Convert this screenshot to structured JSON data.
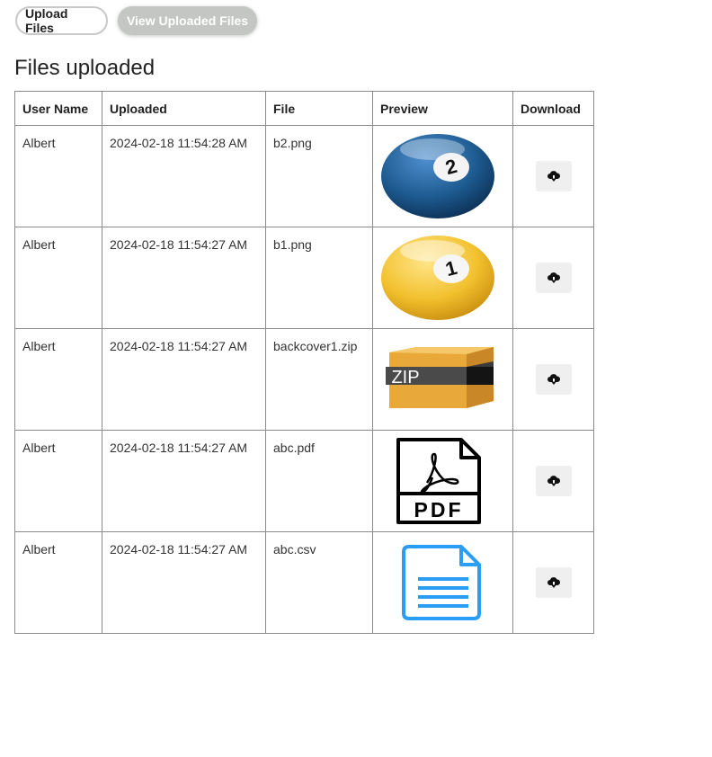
{
  "nav": {
    "upload_label": "Upload Files",
    "view_label": "View Uploaded Files"
  },
  "page_title": "Files uploaded",
  "table": {
    "headers": [
      "User Name",
      "Uploaded",
      "File",
      "Preview",
      "Download"
    ],
    "rows": [
      {
        "user": "Albert",
        "uploaded": "2024-02-18 11:54:28 AM",
        "file": "b2.png",
        "preview": "blue-pool-ball-2",
        "ball_number": "2"
      },
      {
        "user": "Albert",
        "uploaded": "2024-02-18 11:54:27 AM",
        "file": "b1.png",
        "preview": "yellow-pool-ball-1",
        "ball_number": "1"
      },
      {
        "user": "Albert",
        "uploaded": "2024-02-18 11:54:27 AM",
        "file": "backcover1.zip",
        "preview": "zip-archive-icon",
        "zip_text": "ZIP"
      },
      {
        "user": "Albert",
        "uploaded": "2024-02-18 11:54:27 AM",
        "file": "abc.pdf",
        "preview": "pdf-file-icon",
        "pdf_text": "PDF"
      },
      {
        "user": "Albert",
        "uploaded": "2024-02-18 11:54:27 AM",
        "file": "abc.csv",
        "preview": "document-file-icon"
      }
    ]
  },
  "icons": {
    "download": "cloud-download-icon"
  },
  "colors": {
    "blue_ball": "#1d5a8f",
    "yellow_ball": "#f2c12e",
    "zip_box": "#e9a93a",
    "csv_doc": "#2a9df4",
    "view_tab_bg": "#c4c6c4"
  }
}
